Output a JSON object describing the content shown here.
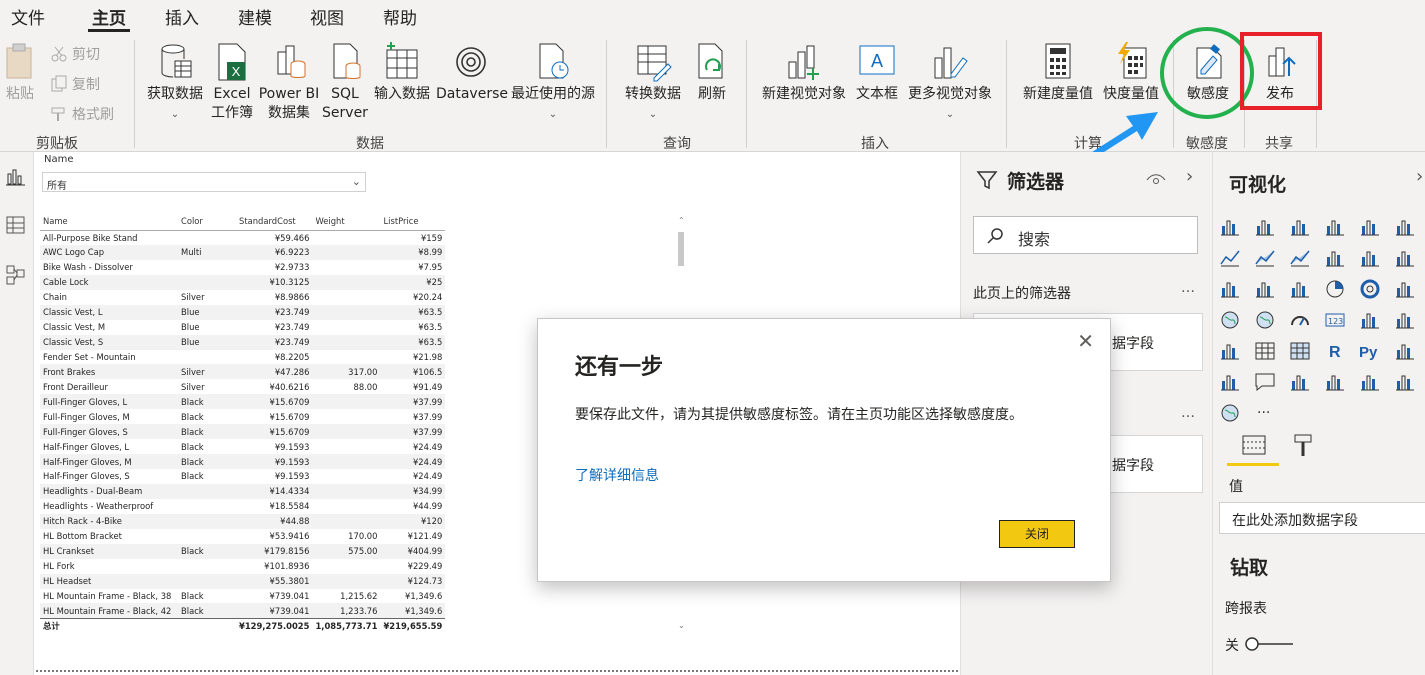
{
  "menu": [
    "文件",
    "主页",
    "插入",
    "建模",
    "视图",
    "帮助"
  ],
  "ribbon": {
    "clipboard": {
      "paste": "粘贴",
      "cut": "剪切",
      "copy": "复制",
      "format_painter": "格式刷",
      "group": "剪贴板"
    },
    "data": {
      "get_data": "获取数据",
      "excel_1": "Excel",
      "excel_2": "工作簿",
      "pbi_1": "Power BI",
      "pbi_2": "数据集",
      "sql_1": "SQL",
      "sql_2": "Server",
      "enter_data": "输入数据",
      "dataverse": "Dataverse",
      "recent": "最近使用的源",
      "group": "数据"
    },
    "query": {
      "transform": "转换数据",
      "refresh": "刷新",
      "group": "查询"
    },
    "insert": {
      "new_visual": "新建视觉对象",
      "textbox": "文本框",
      "more_visuals": "更多视觉对象",
      "group": "插入"
    },
    "calc": {
      "new_measure": "新建度量值",
      "quick_measure": "快度量值",
      "group": "计算"
    },
    "sensitivity": {
      "label": "敏感度",
      "group": "敏感度"
    },
    "share": {
      "publish": "发布",
      "group": "共享"
    }
  },
  "slicer": {
    "title": "Name",
    "value": "所有"
  },
  "table": {
    "headers": [
      "Name",
      "Color",
      "StandardCost",
      "Weight",
      "ListPrice"
    ],
    "rows": [
      [
        "All-Purpose Bike Stand",
        "",
        "¥59.466",
        "",
        "¥159"
      ],
      [
        "AWC Logo Cap",
        "Multi",
        "¥6.9223",
        "",
        "¥8.99"
      ],
      [
        "Bike Wash - Dissolver",
        "",
        "¥2.9733",
        "",
        "¥7.95"
      ],
      [
        "Cable Lock",
        "",
        "¥10.3125",
        "",
        "¥25"
      ],
      [
        "Chain",
        "Silver",
        "¥8.9866",
        "",
        "¥20.24"
      ],
      [
        "Classic Vest, L",
        "Blue",
        "¥23.749",
        "",
        "¥63.5"
      ],
      [
        "Classic Vest, M",
        "Blue",
        "¥23.749",
        "",
        "¥63.5"
      ],
      [
        "Classic Vest, S",
        "Blue",
        "¥23.749",
        "",
        "¥63.5"
      ],
      [
        "Fender Set - Mountain",
        "",
        "¥8.2205",
        "",
        "¥21.98"
      ],
      [
        "Front Brakes",
        "Silver",
        "¥47.286",
        "317.00",
        "¥106.5"
      ],
      [
        "Front Derailleur",
        "Silver",
        "¥40.6216",
        "88.00",
        "¥91.49"
      ],
      [
        "Full-Finger Gloves, L",
        "Black",
        "¥15.6709",
        "",
        "¥37.99"
      ],
      [
        "Full-Finger Gloves, M",
        "Black",
        "¥15.6709",
        "",
        "¥37.99"
      ],
      [
        "Full-Finger Gloves, S",
        "Black",
        "¥15.6709",
        "",
        "¥37.99"
      ],
      [
        "Half-Finger Gloves, L",
        "Black",
        "¥9.1593",
        "",
        "¥24.49"
      ],
      [
        "Half-Finger Gloves, M",
        "Black",
        "¥9.1593",
        "",
        "¥24.49"
      ],
      [
        "Half-Finger Gloves, S",
        "Black",
        "¥9.1593",
        "",
        "¥24.49"
      ],
      [
        "Headlights - Dual-Beam",
        "",
        "¥14.4334",
        "",
        "¥34.99"
      ],
      [
        "Headlights - Weatherproof",
        "",
        "¥18.5584",
        "",
        "¥44.99"
      ],
      [
        "Hitch Rack - 4-Bike",
        "",
        "¥44.88",
        "",
        "¥120"
      ],
      [
        "HL Bottom Bracket",
        "",
        "¥53.9416",
        "170.00",
        "¥121.49"
      ],
      [
        "HL Crankset",
        "Black",
        "¥179.8156",
        "575.00",
        "¥404.99"
      ],
      [
        "HL Fork",
        "",
        "¥101.8936",
        "",
        "¥229.49"
      ],
      [
        "HL Headset",
        "",
        "¥55.3801",
        "",
        "¥124.73"
      ],
      [
        "HL Mountain Frame - Black, 38",
        "Black",
        "¥739.041",
        "1,215.62",
        "¥1,349.6"
      ],
      [
        "HL Mountain Frame - Black, 42",
        "Black",
        "¥739.041",
        "1,233.76",
        "¥1,349.6"
      ]
    ],
    "total": [
      "总计",
      "",
      "¥129,275.0025",
      "1,085,773.71",
      "¥219,655.59"
    ]
  },
  "filters": {
    "title": "筛选器",
    "search_placeholder": "搜索",
    "page_filters": "此页上的筛选器",
    "field_hint": "据字段",
    "more": "…"
  },
  "viz": {
    "title": "可视化",
    "values_label": "值",
    "add_field": "在此处添加数据字段",
    "drill": "钻取",
    "cross_report": "跨报表",
    "toggle_label": "关"
  },
  "dialog": {
    "title": "还有一步",
    "body": "要保存此文件，请为其提供敏感度标签。请在主页功能区选择敏感度度。",
    "link": "了解详细信息",
    "close_button": "关闭"
  },
  "colors": {
    "accent_yellow": "#f2c811",
    "annotation_green": "#22b14c",
    "annotation_red": "#e8202a",
    "annotation_arrow": "#2196f3"
  }
}
